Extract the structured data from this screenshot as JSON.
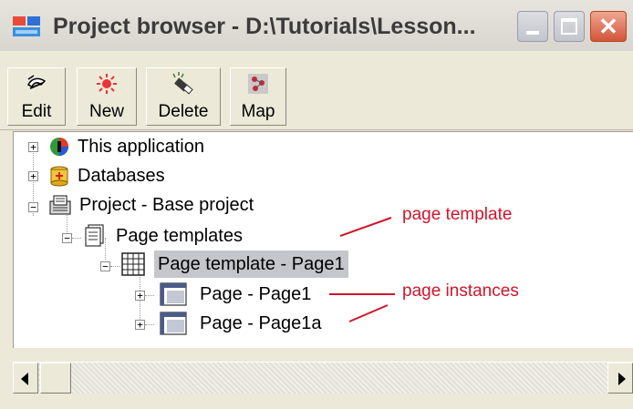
{
  "window": {
    "title": "Project browser - D:\\Tutorials\\Lesson...",
    "minimize_icon": "minimize-icon",
    "maximize_icon": "maximize-icon",
    "close_icon": "close-icon",
    "close_glyph": "✕"
  },
  "toolbar": {
    "buttons": [
      {
        "label": "Edit",
        "icon": "edit-icon"
      },
      {
        "label": "New",
        "icon": "new-icon"
      },
      {
        "label": "Delete",
        "icon": "delete-icon"
      },
      {
        "label": "Map",
        "icon": "map-icon"
      }
    ]
  },
  "tree": {
    "nodes": [
      {
        "label": "This application",
        "icon": "application-icon",
        "expander": "+"
      },
      {
        "label": "Databases",
        "icon": "database-icon",
        "expander": "+"
      },
      {
        "label": "Project - Base project",
        "icon": "project-icon",
        "expander": "−"
      },
      {
        "label": "Page templates",
        "icon": "page-templates-icon",
        "expander": "−"
      },
      {
        "label": "Page template - Page1",
        "icon": "page-template-icon",
        "expander": "−"
      },
      {
        "label": "Page - Page1",
        "icon": "page-icon",
        "expander": "+"
      },
      {
        "label": "Page - Page1a",
        "icon": "page-icon",
        "expander": "+"
      }
    ]
  },
  "annotations": {
    "page_template": "page template",
    "page_instances": "page instances",
    "color": "#d0152a"
  },
  "colors": {
    "window_bg": "#ece9d8",
    "close_button": "#d1553a",
    "selection": "#c5c6cc"
  }
}
